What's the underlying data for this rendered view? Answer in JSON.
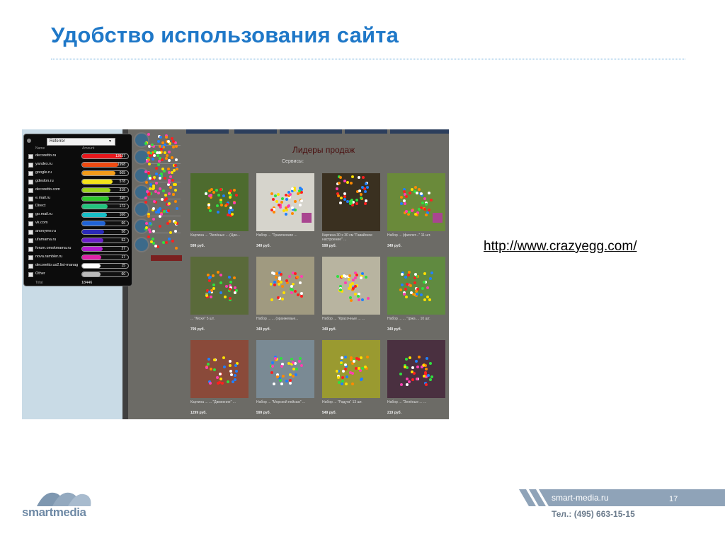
{
  "slide": {
    "title": "Удобство использования сайта",
    "link": "http://www.crazyegg.com/"
  },
  "screenshot": {
    "section_title": "Лидеры продаж",
    "sort_label": "Сервисы:",
    "referrer_panel": {
      "dropdown_value": "Referrer",
      "col_name": "Name",
      "col_amount": "Amount",
      "rows": [
        {
          "name": "decoretto.ru",
          "value": "13627",
          "fill": 0.88,
          "color": "#e8171c"
        },
        {
          "name": "yandex.ru",
          "value": "1998",
          "fill": 0.78,
          "color": "#ef4b12"
        },
        {
          "name": "google.ru",
          "value": "665",
          "fill": 0.72,
          "color": "#f39c1a"
        },
        {
          "name": "gdeslon.ru",
          "value": "578",
          "fill": 0.66,
          "color": "#f4e31b"
        },
        {
          "name": "decoretto.com",
          "value": "318",
          "fill": 0.62,
          "color": "#9bd21c"
        },
        {
          "name": "e.mail.ru",
          "value": "245",
          "fill": 0.58,
          "color": "#2ec82a"
        },
        {
          "name": "Direct",
          "value": "172",
          "fill": 0.56,
          "color": "#21c47e"
        },
        {
          "name": "go.mail.ru",
          "value": "166",
          "fill": 0.54,
          "color": "#18bfc8"
        },
        {
          "name": "vk.com",
          "value": "66",
          "fill": 0.5,
          "color": "#1f63d6"
        },
        {
          "name": "anonyme.ru",
          "value": "58",
          "fill": 0.47,
          "color": "#2a2ab8"
        },
        {
          "name": "ufamama.ru",
          "value": "52",
          "fill": 0.46,
          "color": "#6a1fc9"
        },
        {
          "name": "forum.omskmama.ru",
          "value": "27",
          "fill": 0.44,
          "color": "#b21bd0"
        },
        {
          "name": "nova.rambler.ru",
          "value": "17",
          "fill": 0.42,
          "color": "#e021a8"
        },
        {
          "name": "decoretto.us2.list-manag",
          "value": "15",
          "fill": 0.4,
          "color": "#ffffff"
        },
        {
          "name": "Other",
          "value": "60",
          "fill": 0.4,
          "color": "#bbbbbb"
        }
      ],
      "total_label": "Total",
      "total_value": "18446"
    },
    "products": [
      {
        "caption": "Картина ... \"Зелёные ... (Цве...",
        "price": "599 руб.",
        "bg": "#4d6b2e"
      },
      {
        "caption": "Набор ... \"Трагические ... ",
        "price": "349 руб.",
        "bg": "#d6d4cc"
      },
      {
        "caption": "Картина 30 х 30 см \"Гавайское настроение\" ...",
        "price": "599 руб.",
        "bg": "#3a3020"
      },
      {
        "caption": "Набор ... (фиолет...\" 11 шт.",
        "price": "349 руб.",
        "bg": "#6a8a3a"
      },
      {
        "caption": "... \"Мохи\" 5 шт.",
        "price": "799 руб.",
        "bg": "#5a6a3a"
      },
      {
        "caption": "Набор ... ... (оранжевые...",
        "price": "349 руб.",
        "bg": "#a09a80"
      },
      {
        "caption": "Набор ... \"Красочные ... ...",
        "price": "349 руб.",
        "bg": "#b8b4a0"
      },
      {
        "caption": "Набор ... ... \"(ржа ... 10 шт.",
        "price": "349 руб.",
        "bg": "#608a40"
      },
      {
        "caption": "Картина ... ... \"Движение\" ...",
        "price": "1299 руб.",
        "bg": "#8a4a3a"
      },
      {
        "caption": "Набор ... \"Морской пейзаж\" ...",
        "price": "599 руб.",
        "bg": "#7a8a94"
      },
      {
        "caption": "Набор ... \"Радуга\" 13 шт.",
        "price": "549 руб.",
        "bg": "#9a9a30"
      },
      {
        "caption": "Набор ... \"Зелёные ... ...",
        "price": "219 руб.",
        "bg": "#4a3040"
      }
    ]
  },
  "footer": {
    "logo": "smartmedia",
    "site": "smart-media.ru",
    "page_number": "17",
    "phone": "Тел.: (495) 663-15-15"
  }
}
